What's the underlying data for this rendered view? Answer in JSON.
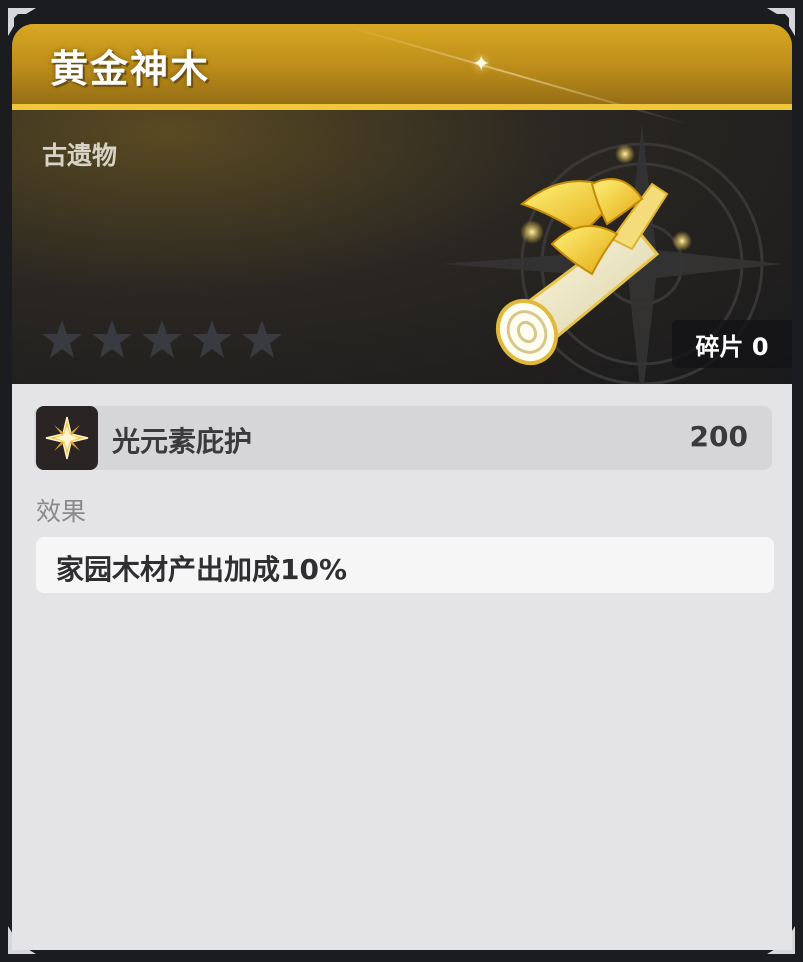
{
  "item": {
    "name": "黄金神木",
    "category": "古遗物",
    "rarity_stars": 5,
    "fragments_label": "碎片 0"
  },
  "stat": {
    "name": "光元素庇护",
    "value": "200",
    "icon": "light-element-icon"
  },
  "effect": {
    "label": "效果",
    "text": "家园木材产出加成10%"
  },
  "colors": {
    "gold": "#d9a822",
    "gold_line": "#f0c63a",
    "panel": "#e4e4e6",
    "header_dark": "#1a1a1c"
  },
  "icons": {
    "item_art": "golden-wood-log-icon",
    "star": "star-icon",
    "corner": "corner-ornament-icon",
    "sparkle": "sparkle-icon",
    "compass": "compass-rose-icon"
  }
}
